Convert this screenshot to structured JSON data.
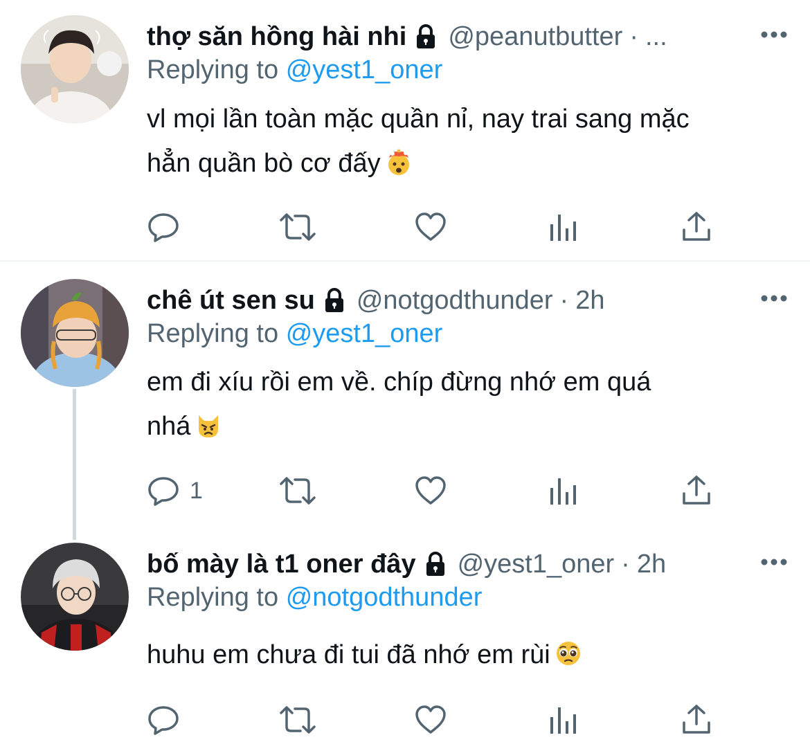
{
  "tweets": [
    {
      "display_name": "thợ săn hồng hài nhi",
      "handle": "@peanutbutter",
      "separator": "·",
      "time": "...",
      "replying_prefix": "Replying to",
      "replying_to": "@yest1_oner",
      "body_lines": [
        "vl mọi lần toàn mặc quần nỉ, nay trai sang mặc",
        "hẳn quần bò cơ đấy"
      ],
      "emoji": "exploding-head-emoji",
      "reply_count": ""
    },
    {
      "display_name": "chê út sen su",
      "handle": "@notgodthunder",
      "separator": "·",
      "time": "2h",
      "replying_prefix": "Replying to",
      "replying_to": "@yest1_oner",
      "body_lines": [
        "em đi xíu rồi em về. chíp đừng nhớ em quá",
        "nhá"
      ],
      "emoji": "pouting-cat-emoji",
      "reply_count": "1"
    },
    {
      "display_name": "bố mày là t1 oner đây",
      "handle": "@yest1_oner",
      "separator": "·",
      "time": "2h",
      "replying_prefix": "Replying to",
      "replying_to": "@notgodthunder",
      "body_lines": [
        "huhu em chưa đi tui đã nhớ em rùi"
      ],
      "emoji": "pleading-face-emoji",
      "reply_count": ""
    }
  ],
  "icons": {
    "reply": "reply-icon",
    "retweet": "retweet-icon",
    "like": "heart-icon",
    "analytics": "analytics-icon",
    "share": "share-icon",
    "lock": "lock-icon",
    "more": "more-icon"
  },
  "colors": {
    "text": "#0f1419",
    "secondary": "#536471",
    "accent": "#1d9bf0",
    "divider": "#eff3f4",
    "thread_line": "#cfd9de"
  }
}
